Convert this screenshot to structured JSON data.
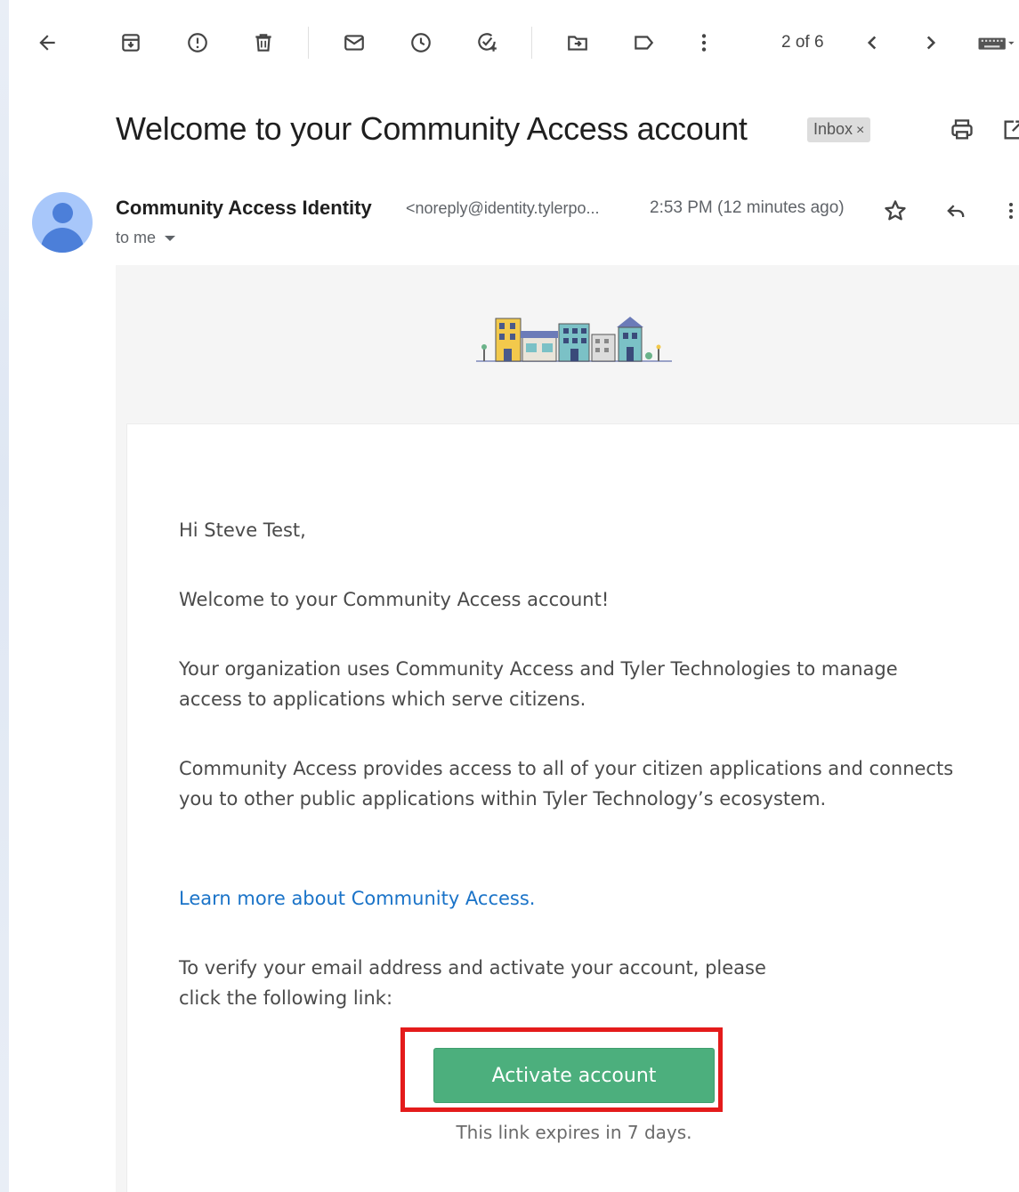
{
  "toolbar": {
    "pagination": "2 of 6"
  },
  "email": {
    "subject": "Welcome to your Community Access account",
    "label": "Inbox",
    "label_remove": "×",
    "sender_name": "Community Access Identity",
    "sender_email": "<noreply@identity.tylerpo...",
    "time": "2:53 PM (12 minutes ago)",
    "to": "to me"
  },
  "body": {
    "greeting": "Hi Steve Test,",
    "welcome": "Welcome to your Community Access account!",
    "para1": "Your organization uses Community Access and Tyler Technologies to manage access to applications which serve citizens.",
    "para2": "Community Access provides access to all of your citizen applications and connects you to other public applications within Tyler Technology’s ecosystem.",
    "learn_more": "Learn more about Community Access.",
    "verify": "To verify your email address and activate your account, please click the following link:",
    "button": "Activate account",
    "expires": "This link expires in 7 days."
  },
  "colors": {
    "button": "#4caf7d",
    "highlight": "#e41b1b",
    "link": "#1a73c8"
  }
}
